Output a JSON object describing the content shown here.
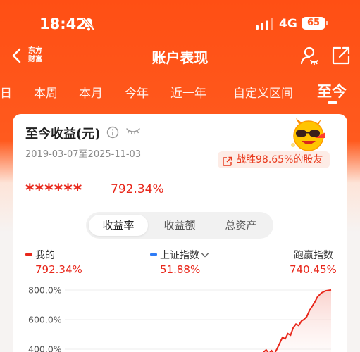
{
  "status_bar": {
    "time": "18:42",
    "network": "4G",
    "battery": "65"
  },
  "nav": {
    "title": "账户表现",
    "logo_line1": "东方",
    "logo_line2": "财富"
  },
  "tabs": [
    {
      "label": "日"
    },
    {
      "label": "本周"
    },
    {
      "label": "本月"
    },
    {
      "label": "今年"
    },
    {
      "label": "近一年"
    },
    {
      "label": "自定义区间"
    },
    {
      "label": "至今"
    }
  ],
  "card": {
    "title": "至今收益(元)",
    "date_range": "2019-03-07至2025-11-03",
    "beat_text": "战胜98.65%的股友",
    "masked_amount": "******",
    "return_pct": "792.34%"
  },
  "segment": {
    "options": [
      "收益率",
      "收益额",
      "总资产"
    ],
    "selected": "收益率"
  },
  "legend": [
    {
      "name": "我的",
      "value": "792.34%",
      "color": "#E8271B"
    },
    {
      "name": "上证指数",
      "value": "51.88%",
      "color": "#2F7CF6"
    },
    {
      "name": "跑赢指数",
      "value": "740.45%",
      "color": "#E8271B"
    }
  ],
  "chart_data": {
    "type": "line",
    "y_ticks": [
      "800.0%",
      "600.0%",
      "400.0%"
    ],
    "ylim": [
      350,
      800
    ],
    "series": [
      {
        "name": "我的",
        "color": "#E8271B",
        "values": [
          [
            0.0,
            380
          ],
          [
            0.04,
            395
          ],
          [
            0.08,
            372
          ],
          [
            0.12,
            390
          ],
          [
            0.16,
            368
          ],
          [
            0.2,
            402
          ],
          [
            0.24,
            440
          ],
          [
            0.28,
            480
          ],
          [
            0.32,
            470
          ],
          [
            0.36,
            505
          ],
          [
            0.4,
            495
          ],
          [
            0.44,
            545
          ],
          [
            0.48,
            570
          ],
          [
            0.52,
            560
          ],
          [
            0.56,
            590
          ],
          [
            0.6,
            602
          ],
          [
            0.64,
            620
          ],
          [
            0.68,
            662
          ],
          [
            0.72,
            690
          ],
          [
            0.76,
            720
          ],
          [
            0.8,
            755
          ],
          [
            0.86,
            782
          ],
          [
            0.92,
            795
          ],
          [
            1.0,
            801
          ]
        ]
      }
    ]
  }
}
